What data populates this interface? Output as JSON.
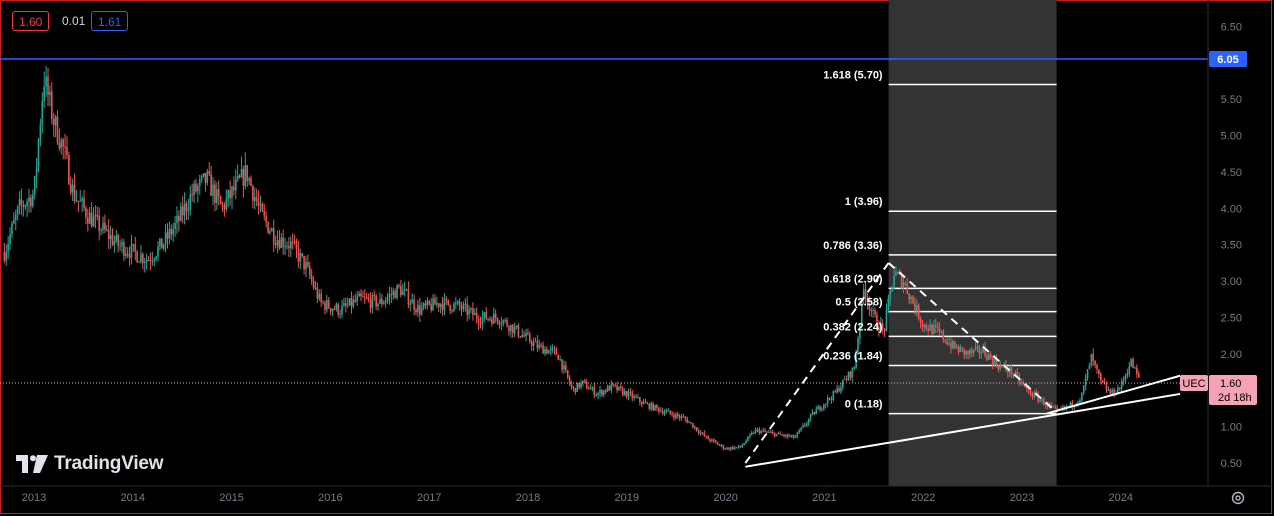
{
  "legend": {
    "bid": "1.60",
    "spread": "0.01",
    "ask": "1.61"
  },
  "brand": {
    "name": "TradingView"
  },
  "icons": {
    "settings": "gear-icon",
    "logo": "tradingview-logo-icon"
  },
  "colors": {
    "up": "#26a69a",
    "down": "#ef5350",
    "accent_line": "#2962ff",
    "frame": "#c81e1e",
    "symbol_tag": "#f7a1b5"
  },
  "price_scale": {
    "ticks": [
      "6.50",
      "6.00",
      "5.50",
      "5.00",
      "4.50",
      "4.00",
      "3.50",
      "3.00",
      "2.50",
      "2.00",
      "1.50",
      "1.00",
      "0.50"
    ],
    "high_label": "6.05",
    "last": {
      "symbol": "UEC",
      "price": "1.60",
      "countdown": "2d 18h"
    }
  },
  "time_scale": {
    "ticks": [
      "2013",
      "2014",
      "2015",
      "2016",
      "2017",
      "2018",
      "2019",
      "2020",
      "2021",
      "2022",
      "2023",
      "2024"
    ]
  },
  "fib_levels": [
    {
      "ratio": 1.618,
      "price": 5.7,
      "label": "1.618 (5.70)"
    },
    {
      "ratio": 1,
      "price": 3.96,
      "label": "1 (3.96)"
    },
    {
      "ratio": 0.786,
      "price": 3.36,
      "label": "0.786 (3.36)"
    },
    {
      "ratio": 0.618,
      "price": 2.9,
      "label": "0.618 (2.90)"
    },
    {
      "ratio": 0.5,
      "price": 2.58,
      "label": "0.5 (2.58)"
    },
    {
      "ratio": 0.382,
      "price": 2.24,
      "label": "0.382 (2.24)"
    },
    {
      "ratio": 0.236,
      "price": 1.84,
      "label": "0.236 (1.84)"
    },
    {
      "ratio": 0,
      "price": 1.18,
      "label": "0 (1.18)"
    }
  ],
  "chart_data": {
    "type": "candlestick",
    "symbol": "UEC",
    "x_unit": "year",
    "xlim": [
      2012.7,
      2024.9
    ],
    "ylim": [
      0.3,
      6.6
    ],
    "price_scale_side": "right",
    "grid": false,
    "series": [
      {
        "x": [
          2012.7,
          2012.85,
          2013.0,
          2013.1,
          2013.2,
          2013.3,
          2013.4,
          2013.55,
          2013.7,
          2013.85,
          2014.0,
          2014.15,
          2014.3,
          2014.45,
          2014.6,
          2014.75,
          2014.9,
          2015.0,
          2015.15,
          2015.3,
          2015.45,
          2015.6,
          2015.75,
          2015.9,
          2016.1,
          2016.3,
          2016.5,
          2016.7,
          2016.9,
          2017.1,
          2017.3,
          2017.5,
          2017.7,
          2017.9,
          2018.1,
          2018.3,
          2018.45,
          2018.55,
          2018.7,
          2018.85,
          2019.0,
          2019.2,
          2019.4,
          2019.6,
          2019.8,
          2020.0,
          2020.15,
          2020.3,
          2020.5,
          2020.7,
          2020.9,
          2021.1,
          2021.3,
          2021.4,
          2021.5,
          2021.6,
          2021.7,
          2021.8,
          2021.9,
          2022.0,
          2022.15,
          2022.3,
          2022.45,
          2022.6,
          2022.75,
          2022.9,
          2023.05,
          2023.2,
          2023.35,
          2023.5,
          2023.6,
          2023.7,
          2023.8,
          2023.9,
          2024.0,
          2024.1,
          2024.2
        ],
        "close": [
          3.4,
          4.0,
          4.2,
          5.8,
          5.2,
          4.8,
          4.2,
          3.9,
          3.7,
          3.5,
          3.4,
          3.3,
          3.5,
          3.8,
          4.2,
          4.4,
          4.0,
          4.2,
          4.5,
          3.9,
          3.6,
          3.5,
          3.2,
          2.7,
          2.6,
          2.75,
          2.7,
          2.9,
          2.6,
          2.7,
          2.65,
          2.5,
          2.5,
          2.3,
          2.1,
          2.0,
          1.5,
          1.6,
          1.45,
          1.55,
          1.45,
          1.3,
          1.2,
          1.1,
          0.85,
          0.7,
          0.72,
          0.95,
          0.9,
          0.85,
          1.2,
          1.45,
          1.8,
          2.9,
          2.5,
          2.3,
          3.1,
          3.0,
          2.7,
          2.4,
          2.3,
          2.1,
          2.0,
          2.05,
          1.85,
          1.75,
          1.5,
          1.35,
          1.2,
          1.3,
          1.4,
          1.95,
          1.6,
          1.45,
          1.55,
          1.9,
          1.6
        ]
      },
      {
        "name": "",
        "type": "horizontal-line",
        "y": 6.05
      },
      {
        "name": "",
        "type": "trendline",
        "x": [
          2020.2,
          2024.6
        ],
        "y": [
          0.45,
          1.45
        ]
      },
      {
        "name": "",
        "type": "trendline",
        "x": [
          2023.25,
          2024.6
        ],
        "y": [
          1.18,
          1.7
        ]
      },
      {
        "name": "",
        "type": "dashed-leg",
        "x": [
          2020.2,
          2021.65
        ],
        "y": [
          0.5,
          3.25
        ]
      },
      {
        "name": "",
        "type": "dashed-leg",
        "x": [
          2021.65,
          2023.35
        ],
        "y": [
          3.25,
          1.2
        ]
      }
    ],
    "fib_zone": {
      "x": [
        2021.65,
        2023.35
      ]
    }
  }
}
